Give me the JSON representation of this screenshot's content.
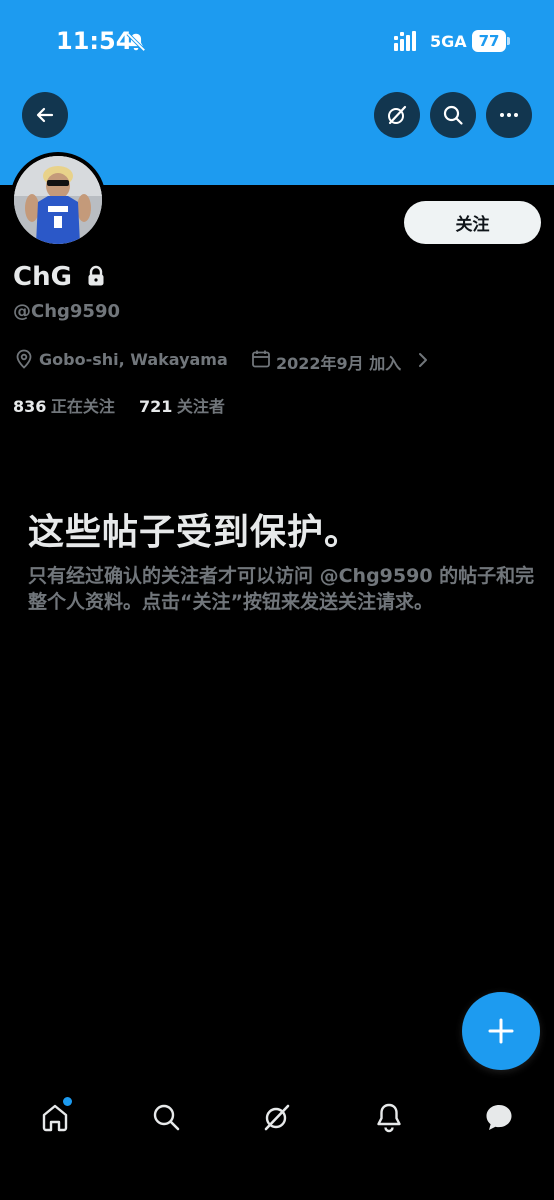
{
  "status_bar": {
    "time": "11:54",
    "network": "5GA",
    "battery": "77"
  },
  "header": {
    "back_icon": "arrow-left-icon",
    "grok_icon": "grok-icon",
    "search_icon": "search-icon",
    "more_icon": "more-horizontal-icon"
  },
  "profile": {
    "display_name": "ChG",
    "username": "@Chg9590",
    "location": "Gobo-shi, Wakayama",
    "joined": "2022年9月 加入",
    "following_count": "836",
    "following_label": "正在关注",
    "followers_count": "721",
    "followers_label": "关注者",
    "follow_button": "关注"
  },
  "protected": {
    "title": "这些帖子受到保护。",
    "body": "只有经过确认的关注者才可以访问 @Chg9590 的帖子和完整个人资料。点击“关注”按钮来发送关注请求。"
  },
  "bottom_nav": {
    "items": [
      "home-icon",
      "search-icon",
      "grok-icon",
      "notifications-icon",
      "messages-icon"
    ]
  },
  "colors": {
    "accent": "#1d9bf0",
    "background": "#000000",
    "secondary_text": "#71767b"
  }
}
